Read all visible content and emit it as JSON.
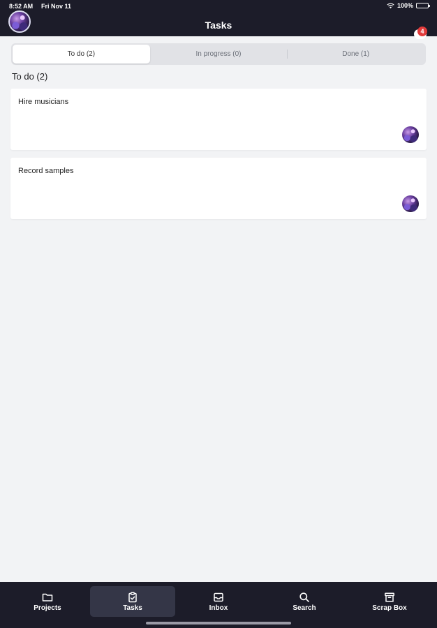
{
  "status_bar": {
    "time": "8:52 AM",
    "date": "Fri Nov 11",
    "battery": "100%"
  },
  "header": {
    "title": "Tasks",
    "notification_count": "4"
  },
  "tabs": [
    {
      "label": "To do (2)",
      "active": true
    },
    {
      "label": "In progress (0)",
      "active": false
    },
    {
      "label": "Done (1)",
      "active": false
    }
  ],
  "section": {
    "title": "To do (2)"
  },
  "tasks": [
    {
      "title": "Hire musicians"
    },
    {
      "title": "Record samples"
    }
  ],
  "bottom_nav": [
    {
      "label": "Projects",
      "icon": "folder-icon",
      "active": false
    },
    {
      "label": "Tasks",
      "icon": "clipboard-check-icon",
      "active": true
    },
    {
      "label": "Inbox",
      "icon": "inbox-icon",
      "active": false
    },
    {
      "label": "Search",
      "icon": "search-icon",
      "active": false
    },
    {
      "label": "Scrap Box",
      "icon": "archive-box-icon",
      "active": false
    }
  ],
  "colors": {
    "header_bg": "#1c1c29",
    "page_bg": "#f2f3f5",
    "badge": "#e23b3b",
    "nav_active_bg": "#343647"
  }
}
